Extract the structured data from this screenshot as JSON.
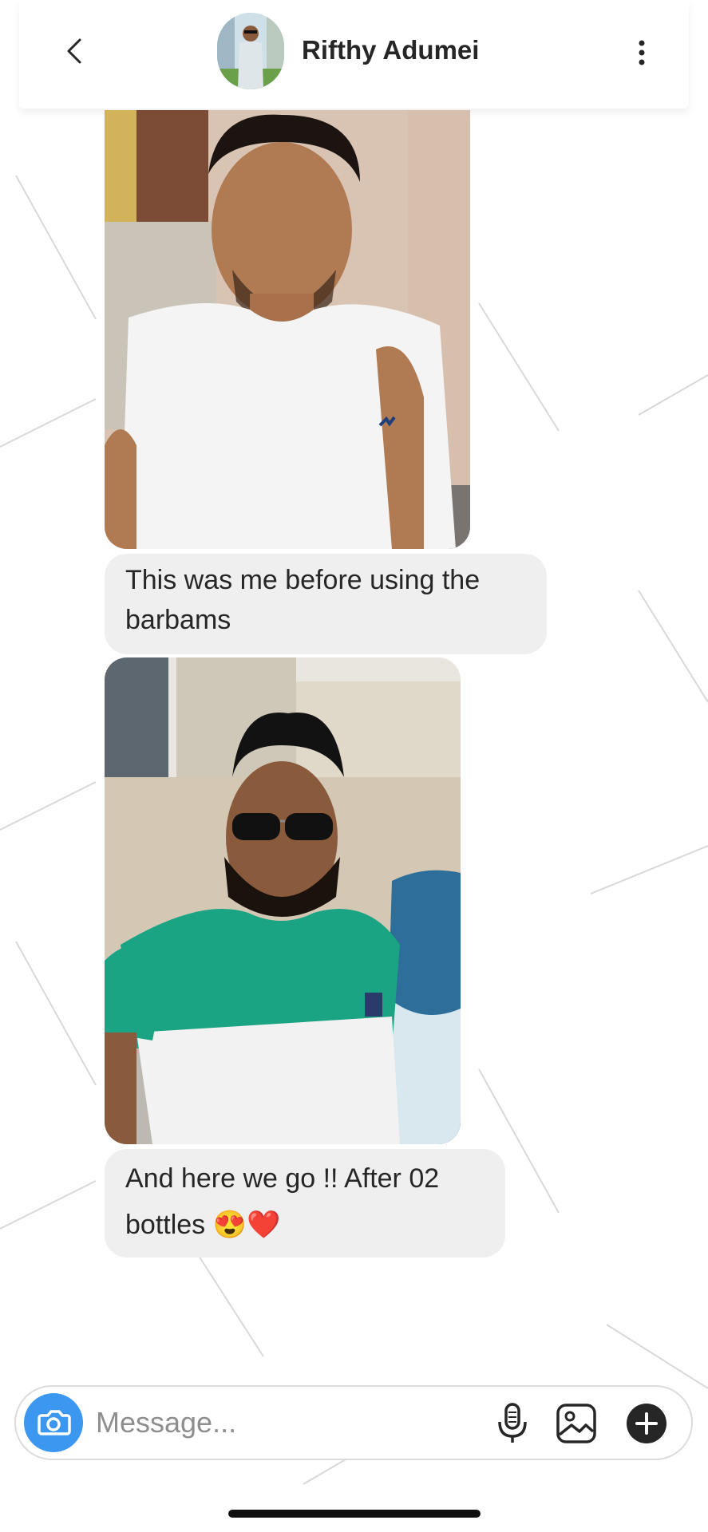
{
  "header": {
    "contact_name": "Rifthy Adumei",
    "back_icon": "chevron-left-icon",
    "more_icon": "vertical-dots-icon"
  },
  "messages": [
    {
      "type": "photo",
      "description_icon": "photo"
    },
    {
      "type": "text",
      "text": "This was me before using the barbams"
    },
    {
      "type": "photo",
      "description_icon": "photo"
    },
    {
      "type": "text",
      "text": "And here we go !! After 02 bottles 😍❤️"
    }
  ],
  "composer": {
    "placeholder": "Message...",
    "camera_icon": "camera-icon",
    "mic_icon": "microphone-icon",
    "gallery_icon": "gallery-icon",
    "plus_icon": "plus-icon"
  },
  "colors": {
    "accent": "#3b97f0",
    "bubble": "#efefef",
    "text": "#262626",
    "placeholder": "#8e8e8e"
  }
}
